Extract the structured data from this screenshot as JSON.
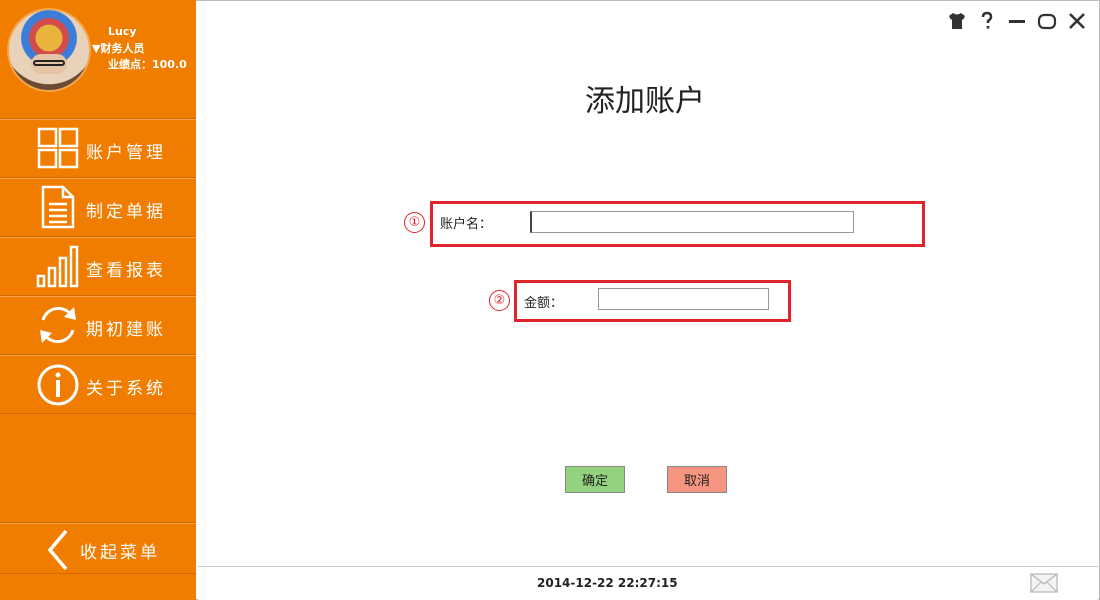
{
  "user": {
    "name": "Lucy",
    "role": "▼财务人员",
    "points": "业绩点：100.0"
  },
  "sidebar": {
    "items": [
      {
        "label": "账户管理",
        "icon": "grid-icon"
      },
      {
        "label": "制定单据",
        "icon": "document-icon"
      },
      {
        "label": "查看报表",
        "icon": "bar-chart-icon"
      },
      {
        "label": "期初建账",
        "icon": "refresh-icon"
      },
      {
        "label": "关于系统",
        "icon": "info-icon"
      }
    ],
    "collapse_label": "收起菜单"
  },
  "page": {
    "title": "添加账户"
  },
  "form": {
    "account_marker": "①",
    "account_label": "账户名：",
    "account_value": "",
    "amount_marker": "②",
    "amount_label": "金额：",
    "amount_value": ""
  },
  "buttons": {
    "confirm": "确定",
    "cancel": "取消"
  },
  "status": {
    "timestamp": "2014-12-22 22:27:15"
  },
  "colors": {
    "sidebar": "#f07d00",
    "confirm": "#93d27e",
    "cancel": "#f69580",
    "highlight": "#e0242b"
  }
}
